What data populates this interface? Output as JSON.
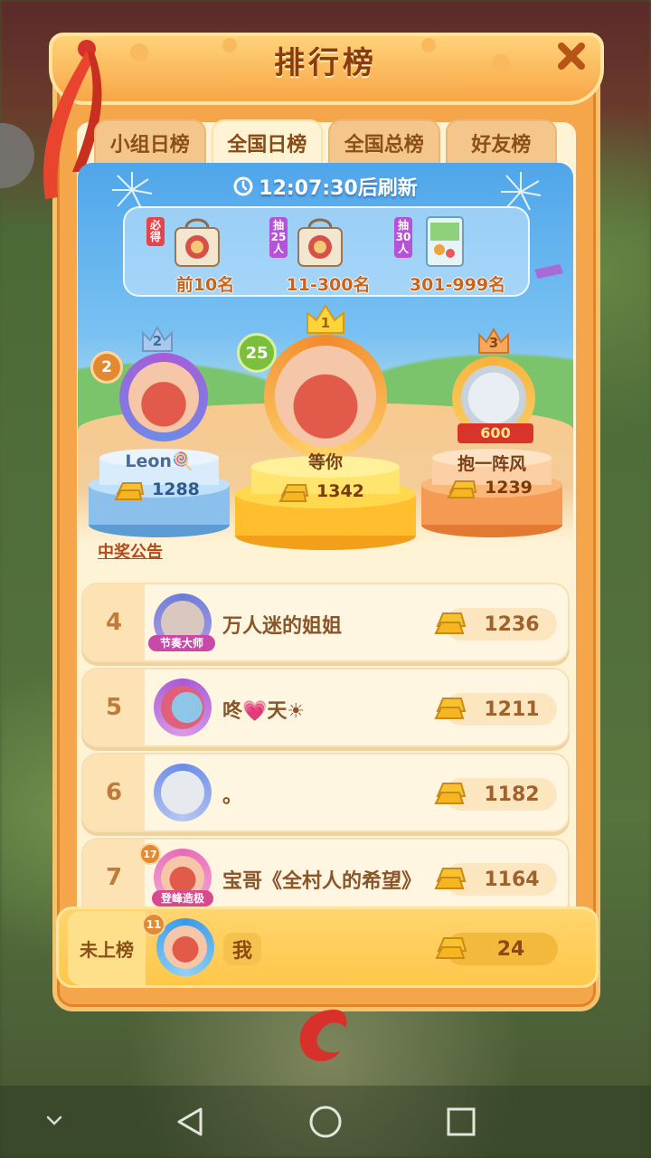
{
  "header": {
    "title": "排行榜"
  },
  "tabs": [
    {
      "label": "小组日榜",
      "active": false
    },
    {
      "label": "全国日榜",
      "active": true
    },
    {
      "label": "全国总榜",
      "active": false
    },
    {
      "label": "好友榜",
      "active": false
    }
  ],
  "timer": {
    "text": "12:07:30后刷新"
  },
  "rewards": [
    {
      "tag": "必得",
      "label": "前10名"
    },
    {
      "tag": "抽25人",
      "label": "11-300名"
    },
    {
      "tag": "抽30人",
      "label": "301-999名"
    }
  ],
  "podium": {
    "first": {
      "rank": "1",
      "level": "25",
      "name": "等你",
      "score": "1342"
    },
    "second": {
      "rank": "2",
      "level": "2",
      "name": "Leon🍭",
      "score": "1288"
    },
    "third": {
      "rank": "3",
      "badge": "600",
      "name": "抱一阵风",
      "score": "1239"
    }
  },
  "announce_link": "中奖公告",
  "rows": [
    {
      "rank": "4",
      "name": "万人迷的姐姐",
      "score": "1236",
      "title_badge": "节奏大师"
    },
    {
      "rank": "5",
      "name": "咚💗天☀",
      "score": "1211"
    },
    {
      "rank": "6",
      "name": "。",
      "score": "1182"
    },
    {
      "rank": "7",
      "name": "宝哥《全村人的希望》",
      "score": "1164",
      "title_badge": "登峰造极",
      "level": "17"
    }
  ],
  "me": {
    "rank_label": "未上榜",
    "level": "11",
    "name": "我",
    "score": "24"
  },
  "colors": {
    "panel": "#f5a64a",
    "accent_text": "#8a3c0c",
    "gold": "#f6b728"
  },
  "icons": [
    "close-icon",
    "clock-icon",
    "gold-bar-icon",
    "crown-icon",
    "back-icon",
    "home-icon",
    "recents-icon",
    "chevron-down-icon"
  ]
}
